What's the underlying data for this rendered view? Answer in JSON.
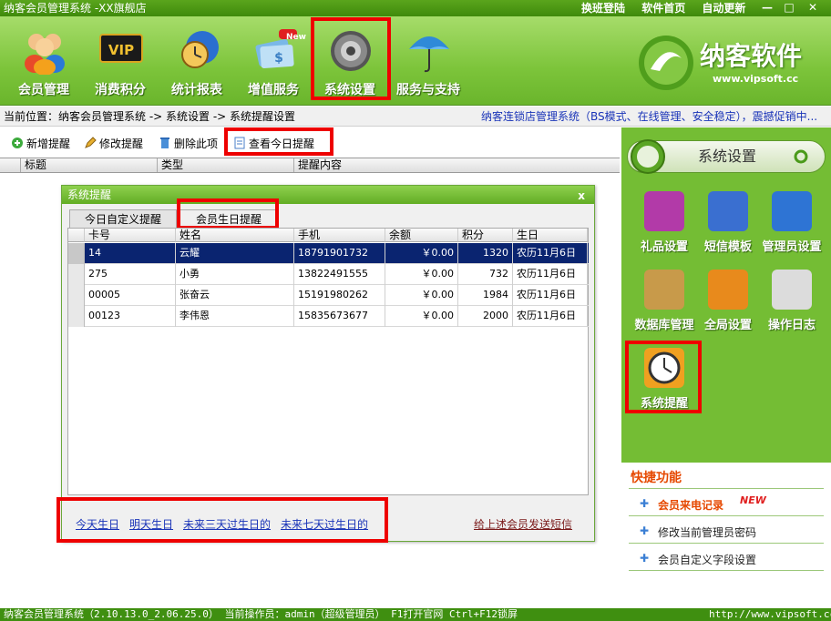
{
  "window": {
    "title": "纳客会员管理系统 -XX旗舰店",
    "links": [
      "换班登陆",
      "软件首页",
      "自动更新"
    ],
    "min": "—",
    "max": "□",
    "close": "✕"
  },
  "toolbar": {
    "items": [
      {
        "label": "会员管理",
        "icon": "members-icon"
      },
      {
        "label": "消费积分",
        "icon": "vip-card-icon"
      },
      {
        "label": "统计报表",
        "icon": "clock-chart-icon"
      },
      {
        "label": "增值服务",
        "icon": "cards-new-icon",
        "badge": "New"
      },
      {
        "label": "系统设置",
        "icon": "gear-icon"
      },
      {
        "label": "服务与支持",
        "icon": "umbrella-icon"
      }
    ],
    "logo_text": "纳客软件",
    "logo_url": "www.vipsoft.cc"
  },
  "location": {
    "path": "当前位置：纳客会员管理系统 -> 系统设置 -> 系统提醒设置",
    "promo": "纳客连锁店管理系统（BS模式、在线管理、安全稳定），震撼促销中..."
  },
  "actions": {
    "add": "新增提醒",
    "edit": "修改提醒",
    "delete": "删除此项",
    "view_today": "查看今日提醒"
  },
  "grid": {
    "headers": [
      "标题",
      "类型",
      "提醒内容"
    ]
  },
  "dialog": {
    "title": "系统提醒",
    "close": "x",
    "tabs": [
      "今日自定义提醒",
      "会员生日提醒"
    ],
    "columns": [
      "卡号",
      "姓名",
      "手机",
      "余额",
      "积分",
      "生日"
    ],
    "rows": [
      {
        "card": "14",
        "name": "云耀",
        "phone": "18791901732",
        "balance": "￥0.00",
        "points": "1320",
        "birthday": "农历11月6日"
      },
      {
        "card": "275",
        "name": "小勇",
        "phone": "13822491555",
        "balance": "￥0.00",
        "points": "732",
        "birthday": "农历11月6日"
      },
      {
        "card": "00005",
        "name": "张奋云",
        "phone": "15191980262",
        "balance": "￥0.00",
        "points": "1984",
        "birthday": "农历11月6日"
      },
      {
        "card": "00123",
        "name": "李伟恩",
        "phone": "15835673677",
        "balance": "￥0.00",
        "points": "2000",
        "birthday": "农历11月6日"
      }
    ],
    "filters": [
      "今天生日",
      "明天生日",
      "未来三天过生日的",
      "未来七天过生日的"
    ],
    "send_sms": "给上述会员发送短信"
  },
  "right_panel": {
    "title": "系统设置",
    "items": [
      {
        "label": "礼品设置",
        "color": "#b23aa8"
      },
      {
        "label": "短信模板",
        "color": "#3a6fd0"
      },
      {
        "label": "管理员设置",
        "color": "#2e74d4"
      },
      {
        "label": "数据库管理",
        "color": "#c89a4a"
      },
      {
        "label": "全局设置",
        "color": "#e88a1c"
      },
      {
        "label": "操作日志",
        "color": "#dcdcdc"
      },
      {
        "label": "系统提醒",
        "color": "#f0a020"
      }
    ],
    "quick_title": "快捷功能",
    "quick_items": [
      "会员来电记录",
      "修改当前管理员密码",
      "会员自定义字段设置"
    ],
    "quick_new": "NEW"
  },
  "status": {
    "left": "纳客会员管理系统（2.10.13.0_2.06.25.0） 当前操作员：admin（超级管理员） F1打开官网 Ctrl+F12锁屏",
    "right": "http://www.vipsoft.cc"
  }
}
